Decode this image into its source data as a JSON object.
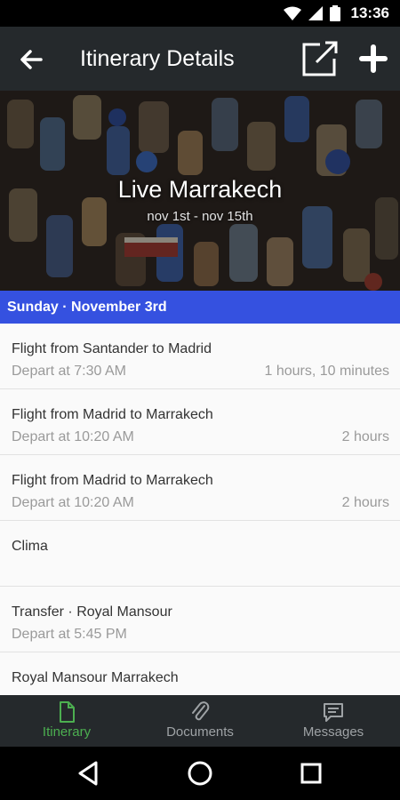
{
  "status_bar": {
    "time": "13:36"
  },
  "app_bar": {
    "title": "Itinerary Details"
  },
  "hero": {
    "title": "Live Marrakech",
    "dates": "nov 1st - nov 15th"
  },
  "day_header": "Sunday · November 3rd",
  "items": [
    {
      "title": "Flight from Santander to Madrid",
      "sub": "Depart at 7:30 AM",
      "duration": "1 hours, 10 minutes"
    },
    {
      "title": "Flight from Madrid to Marrakech",
      "sub": "Depart at 10:20 AM",
      "duration": "2 hours"
    },
    {
      "title": "Flight from Madrid to Marrakech",
      "sub": "Depart at 10:20 AM",
      "duration": "2 hours"
    },
    {
      "title": "Clima",
      "sub": "",
      "duration": ""
    },
    {
      "title": "Transfer · Royal Mansour",
      "sub": "Depart at 5:45 PM",
      "duration": ""
    },
    {
      "title": "Royal Mansour Marrakech",
      "sub": "",
      "duration": ""
    }
  ],
  "bottom_nav": {
    "tabs": [
      {
        "label": "Itinerary",
        "icon": "document-icon",
        "active": true
      },
      {
        "label": "Documents",
        "icon": "paperclip-icon",
        "active": false
      },
      {
        "label": "Messages",
        "icon": "message-icon",
        "active": false
      }
    ]
  },
  "colors": {
    "app_bar": "#25292c",
    "day_header": "#3551e0",
    "active_tab": "#4caf50"
  }
}
